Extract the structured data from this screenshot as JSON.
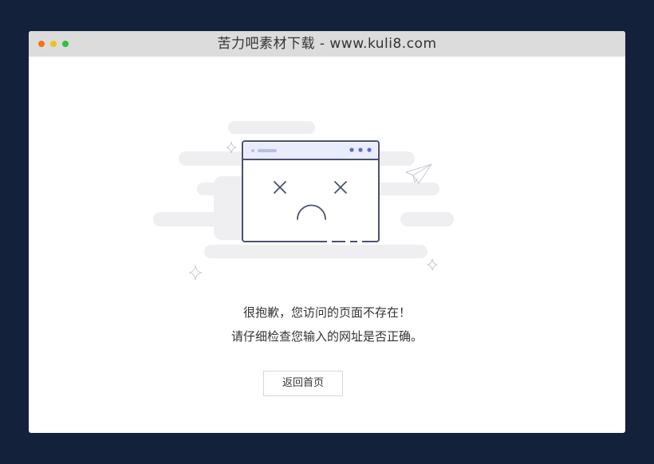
{
  "window": {
    "title": "苦力吧素材下载 - www.kuli8.com",
    "controls": [
      {
        "name": "close",
        "color": "#f5701b"
      },
      {
        "name": "minimize",
        "color": "#f1c21b"
      },
      {
        "name": "maximize",
        "color": "#2cc23d"
      }
    ]
  },
  "error_page": {
    "message_line1": "很抱歉，您访问的页面不存在！",
    "message_line2": "请仔细检查您输入的网址是否正确。",
    "back_button_label": "返回首页",
    "illustration_icon": "sad-browser-window"
  },
  "colors": {
    "page_background": "#13213a",
    "titlebar": "#dcdcdc",
    "illustration_stroke": "#4a5170",
    "illustration_accent": "#5c6fc4",
    "cloud": "#efeff2"
  }
}
